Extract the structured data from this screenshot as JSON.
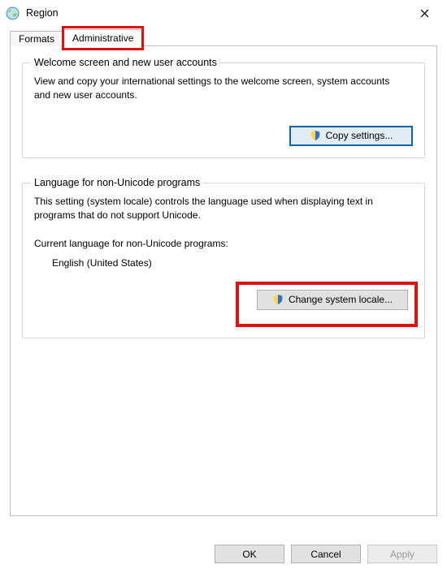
{
  "window": {
    "title": "Region"
  },
  "tabs": {
    "formats": "Formats",
    "administrative": "Administrative"
  },
  "groups": {
    "welcome": {
      "title": "Welcome screen and new user accounts",
      "desc": "View and copy your international settings to the welcome screen, system accounts and new user accounts.",
      "copy_button": "Copy settings..."
    },
    "nonunicode": {
      "title": "Language for non-Unicode programs",
      "desc": "This setting (system locale) controls the language used when displaying text in programs that do not support Unicode.",
      "current_label": "Current language for non-Unicode programs:",
      "current_value": "English (United States)",
      "change_button": "Change system locale..."
    }
  },
  "footer": {
    "ok": "OK",
    "cancel": "Cancel",
    "apply": "Apply"
  }
}
